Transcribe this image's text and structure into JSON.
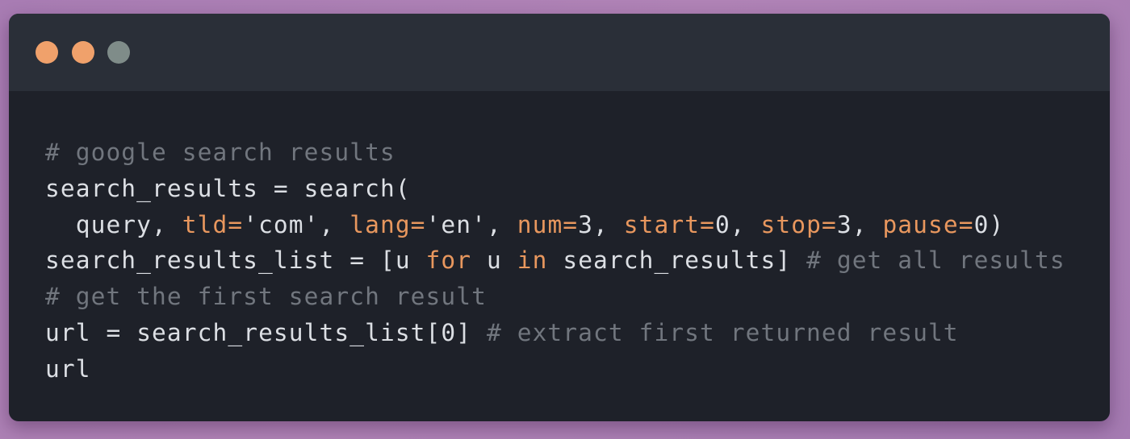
{
  "window": {
    "traffic_lights": [
      {
        "name": "close",
        "color": "#f0a16b"
      },
      {
        "name": "minimize",
        "color": "#f0a16b"
      },
      {
        "name": "zoom",
        "color": "#7f8c89"
      }
    ]
  },
  "colors": {
    "comment": "#71767e",
    "keyword": "#e8975e",
    "text": "#dcdfe4",
    "operator": "#dcdfe4",
    "background": "#1e2129",
    "titlebar": "#2a2f38"
  },
  "code": {
    "lines": [
      [
        {
          "t": "comment",
          "v": "# google search results"
        }
      ],
      [
        {
          "t": "text",
          "v": "search_results "
        },
        {
          "t": "operator",
          "v": "="
        },
        {
          "t": "text",
          "v": " search("
        }
      ],
      [
        {
          "t": "text",
          "v": "  query, "
        },
        {
          "t": "keyword",
          "v": "tld="
        },
        {
          "t": "text",
          "v": "'com', "
        },
        {
          "t": "keyword",
          "v": "lang="
        },
        {
          "t": "text",
          "v": "'en', "
        },
        {
          "t": "keyword",
          "v": "num="
        },
        {
          "t": "text",
          "v": "3, "
        },
        {
          "t": "keyword",
          "v": "start="
        },
        {
          "t": "text",
          "v": "0, "
        },
        {
          "t": "keyword",
          "v": "stop="
        },
        {
          "t": "text",
          "v": "3, "
        },
        {
          "t": "keyword",
          "v": "pause="
        },
        {
          "t": "text",
          "v": "0)"
        }
      ],
      [
        {
          "t": "text",
          "v": "search_results_list "
        },
        {
          "t": "operator",
          "v": "="
        },
        {
          "t": "text",
          "v": " [u "
        },
        {
          "t": "keyword",
          "v": "for"
        },
        {
          "t": "text",
          "v": " u "
        },
        {
          "t": "keyword",
          "v": "in"
        },
        {
          "t": "text",
          "v": " search_results] "
        },
        {
          "t": "comment",
          "v": "# get all results"
        }
      ],
      [
        {
          "t": "comment",
          "v": "# get the first search result"
        }
      ],
      [
        {
          "t": "text",
          "v": "url "
        },
        {
          "t": "operator",
          "v": "="
        },
        {
          "t": "text",
          "v": " search_results_list[0] "
        },
        {
          "t": "comment",
          "v": "# extract first returned result"
        }
      ],
      [
        {
          "t": "text",
          "v": "url"
        }
      ]
    ]
  }
}
